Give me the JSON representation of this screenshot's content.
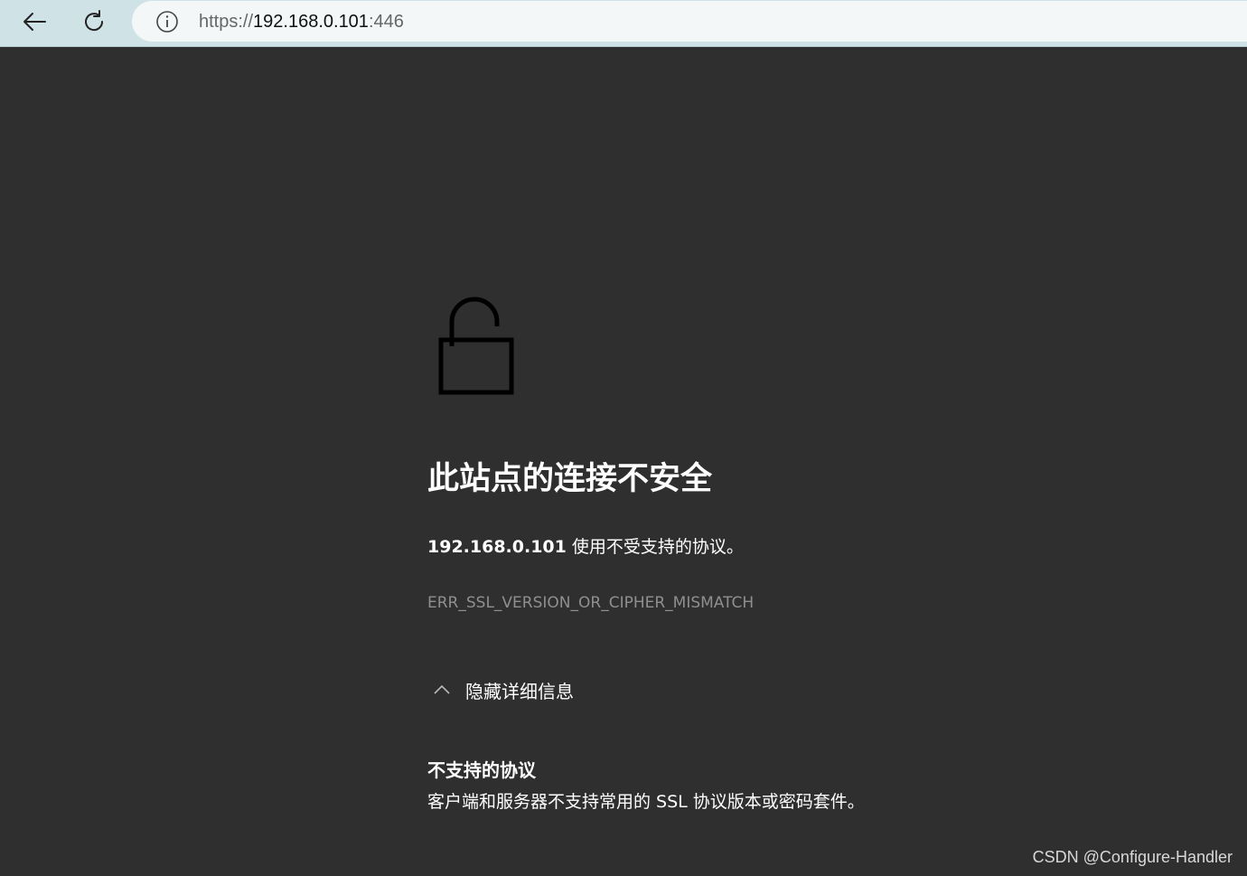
{
  "browser": {
    "back_icon": "arrow-left-icon",
    "reload_icon": "reload-icon",
    "address": {
      "scheme": "https://",
      "host": "192.168.0.101",
      "port": ":446",
      "icon": "info-icon"
    }
  },
  "error_page": {
    "icon": "unlocked-padlock-icon",
    "title": "此站点的连接不安全",
    "host": "192.168.0.101",
    "description_suffix": " 使用不受支持的协议。",
    "error_code": "ERR_SSL_VERSION_OR_CIPHER_MISMATCH",
    "details_toggle_label": "隐藏详细信息",
    "details_toggle_icon": "chevron-up-icon",
    "details_title": "不支持的协议",
    "details_body": "客户端和服务器不支持常用的 SSL 协议版本或密码套件。"
  },
  "watermark": "CSDN @Configure-Handler",
  "colors": {
    "page_background": "#2f2f2f",
    "toolbar_background": "#cfe3e6",
    "address_background": "#f3f7f7",
    "error_code_text": "#8f8f8f"
  }
}
